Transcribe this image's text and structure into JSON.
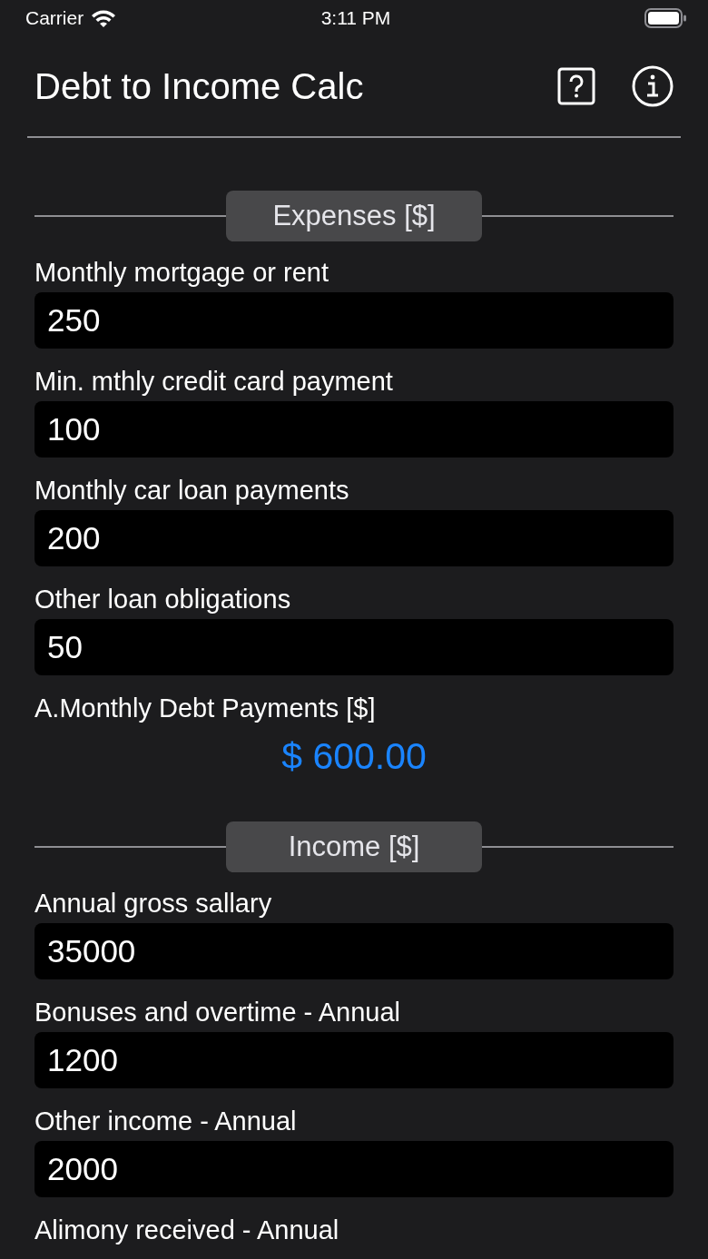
{
  "status_bar": {
    "carrier": "Carrier",
    "time": "3:11 PM"
  },
  "header": {
    "title": "Debt to Income Calc"
  },
  "sections": [
    {
      "title": "Expenses [$]",
      "fields": [
        {
          "label": "Monthly mortgage or rent",
          "value": "250"
        },
        {
          "label": "Min. mthly credit card payment",
          "value": "100"
        },
        {
          "label": "Monthly car loan payments",
          "value": "200"
        },
        {
          "label": "Other loan obligations",
          "value": "50"
        }
      ],
      "result": {
        "label": "A.Monthly Debt Payments [$]",
        "value": "$ 600.00"
      }
    },
    {
      "title": "Income [$]",
      "fields": [
        {
          "label": "Annual gross sallary",
          "value": "35000"
        },
        {
          "label": "Bonuses and overtime - Annual",
          "value": "1200"
        },
        {
          "label": "Other income - Annual",
          "value": "2000"
        },
        {
          "label": "Alimony received - Annual"
        }
      ]
    }
  ]
}
